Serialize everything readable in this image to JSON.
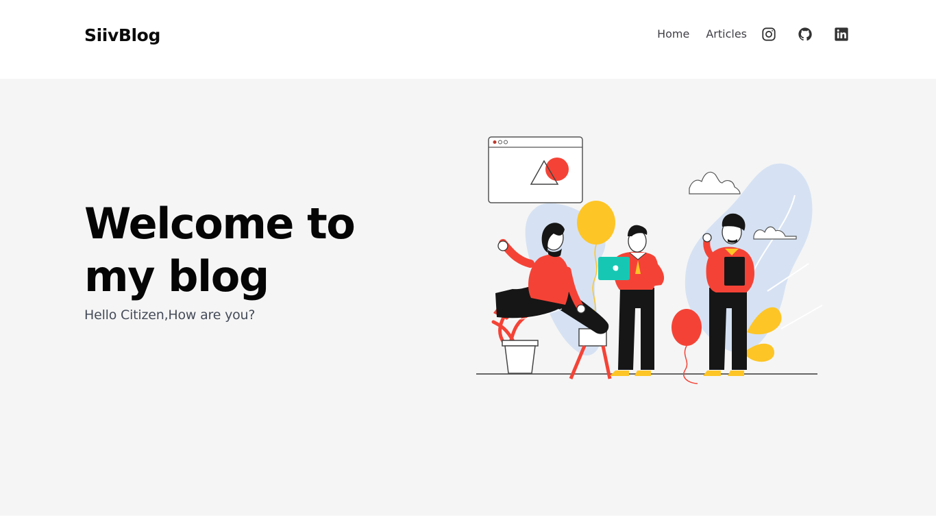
{
  "header": {
    "logo": "SiivBlog",
    "nav": {
      "home_label": "Home",
      "articles_label": "Articles"
    },
    "social_icons": [
      "instagram-icon",
      "github-icon",
      "linkedin-icon"
    ]
  },
  "hero": {
    "title": "Welcome to my blog",
    "subtitle": "Hello Citizen,How are you?"
  },
  "colors": {
    "header_background": "#ffffff",
    "hero_background": "#f5f5f5",
    "accent_red": "#f44336",
    "accent_yellow": "#fdc526",
    "accent_teal": "#16c8b4",
    "illustration_blue": "#d6e2f3"
  }
}
